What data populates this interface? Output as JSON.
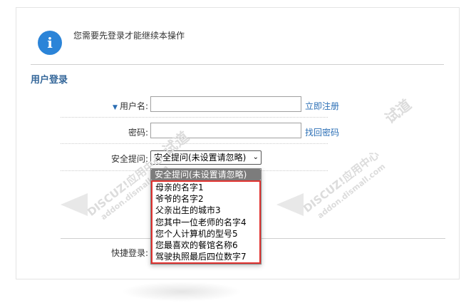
{
  "notice": {
    "icon": "info-icon",
    "glyph": "i",
    "message": "您需要先登录才能继续本操作"
  },
  "login": {
    "section_title": "用户登录",
    "username_label": "用户名:",
    "username_value": "",
    "register_link": "立即注册",
    "password_label": "密码:",
    "password_value": "",
    "find_password_link": "找回密码",
    "security_label": "安全提问:",
    "security_selected": "安全提问(未设置请忽略)",
    "security_options": [
      "安全提问(未设置请忽略)",
      "母亲的名字1",
      "爷爷的名字2",
      "父亲出生的城市3",
      "您其中一位老师的名字4",
      "您个人计算机的型号5",
      "您最喜欢的餐馆名称6",
      "驾驶执照最后四位数字7"
    ],
    "quick_login_label": "快捷登录:"
  },
  "watermark": {
    "brand": "DISCUZ!应用中心",
    "domain": "addon.dismall.com",
    "mark": "试道"
  },
  "colors": {
    "accent": "#2b84d8",
    "link": "#2b6fb6",
    "title": "#336699",
    "highlight_border": "#e0322f"
  }
}
